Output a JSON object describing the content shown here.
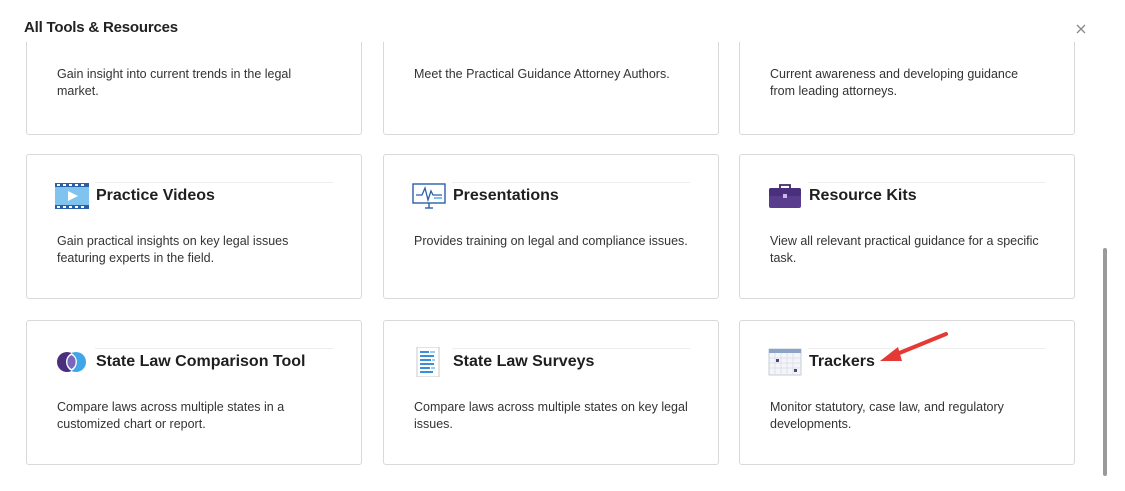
{
  "modal": {
    "title": "All Tools & Resources",
    "close_icon": "close-icon"
  },
  "colors": {
    "accent_purple": "#5a3c8f",
    "icon_blue": "#3a8fd6",
    "annotation_red": "#e53935"
  },
  "cards": [
    {
      "title": "",
      "description": "Gain insight into current trends in the legal market.",
      "icon": "partial-icon"
    },
    {
      "title": "",
      "description": "Meet the Practical Guidance Attorney Authors.",
      "icon": "partial-icon"
    },
    {
      "title": "",
      "description": "Current awareness and developing guidance from leading attorneys.",
      "icon": "partial-icon"
    },
    {
      "title": "Practice Videos",
      "description": "Gain practical insights on key legal issues featuring experts in the field.",
      "icon": "film-icon"
    },
    {
      "title": "Presentations",
      "description": "Provides training on legal and compliance issues.",
      "icon": "presentation-board-icon"
    },
    {
      "title": "Resource Kits",
      "description": "View all relevant practical guidance for a specific task.",
      "icon": "briefcase-icon"
    },
    {
      "title": "State Law Comparison Tool",
      "description": "Compare laws across multiple states in a customized chart or report.",
      "icon": "venn-circles-icon"
    },
    {
      "title": "State Law Surveys",
      "description": "Compare laws across multiple states on key legal issues.",
      "icon": "document-list-icon"
    },
    {
      "title": "Trackers",
      "description": "Monitor statutory, case law, and regulatory developments.",
      "icon": "calendar-grid-icon"
    }
  ]
}
